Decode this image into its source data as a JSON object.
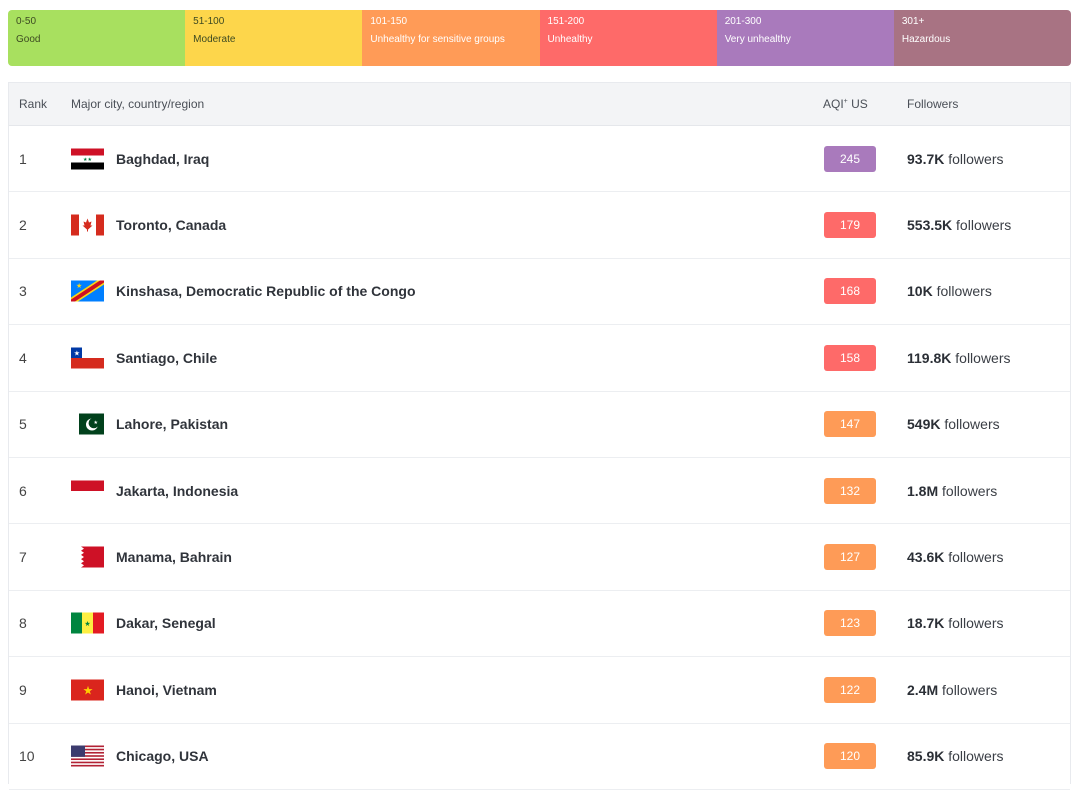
{
  "legend": [
    {
      "range": "0-50",
      "label": "Good",
      "color": "#a8e05f"
    },
    {
      "range": "51-100",
      "label": "Moderate",
      "color": "#fdd64b"
    },
    {
      "range": "101-150",
      "label": "Unhealthy for sensitive groups",
      "color": "#ff9b57"
    },
    {
      "range": "151-200",
      "label": "Unhealthy",
      "color": "#fe6a69"
    },
    {
      "range": "201-300",
      "label": "Very unhealthy",
      "color": "#a97abc"
    },
    {
      "range": "301+",
      "label": "Hazardous",
      "color": "#a87383"
    }
  ],
  "table": {
    "headers": {
      "rank": "Rank",
      "city": "Major city, country/region",
      "aqi_prefix": "AQI",
      "aqi_sup": "+",
      "aqi_suffix": " US",
      "followers": "Followers"
    },
    "followers_word": "followers",
    "rows": [
      {
        "rank": "1",
        "flag": "iraq-flag-icon",
        "city": "Baghdad, Iraq",
        "aqi": "245",
        "aqi_color": "#a97abc",
        "followers": "93.7K"
      },
      {
        "rank": "2",
        "flag": "canada-flag-icon",
        "city": "Toronto, Canada",
        "aqi": "179",
        "aqi_color": "#fe6a69",
        "followers": "553.5K"
      },
      {
        "rank": "3",
        "flag": "dr-congo-flag-icon",
        "city": "Kinshasa, Democratic Republic of the Congo",
        "aqi": "168",
        "aqi_color": "#fe6a69",
        "followers": "10K"
      },
      {
        "rank": "4",
        "flag": "chile-flag-icon",
        "city": "Santiago, Chile",
        "aqi": "158",
        "aqi_color": "#fe6a69",
        "followers": "119.8K"
      },
      {
        "rank": "5",
        "flag": "pakistan-flag-icon",
        "city": "Lahore, Pakistan",
        "aqi": "147",
        "aqi_color": "#fe9b57",
        "followers": "549K"
      },
      {
        "rank": "6",
        "flag": "indonesia-flag-icon",
        "city": "Jakarta, Indonesia",
        "aqi": "132",
        "aqi_color": "#fe9b57",
        "followers": "1.8M"
      },
      {
        "rank": "7",
        "flag": "bahrain-flag-icon",
        "city": "Manama, Bahrain",
        "aqi": "127",
        "aqi_color": "#fe9b57",
        "followers": "43.6K"
      },
      {
        "rank": "8",
        "flag": "senegal-flag-icon",
        "city": "Dakar, Senegal",
        "aqi": "123",
        "aqi_color": "#fe9b57",
        "followers": "18.7K"
      },
      {
        "rank": "9",
        "flag": "vietnam-flag-icon",
        "city": "Hanoi, Vietnam",
        "aqi": "122",
        "aqi_color": "#fe9b57",
        "followers": "2.4M"
      },
      {
        "rank": "10",
        "flag": "usa-flag-icon",
        "city": "Chicago, USA",
        "aqi": "120",
        "aqi_color": "#fe9b57",
        "followers": "85.9K"
      }
    ]
  }
}
